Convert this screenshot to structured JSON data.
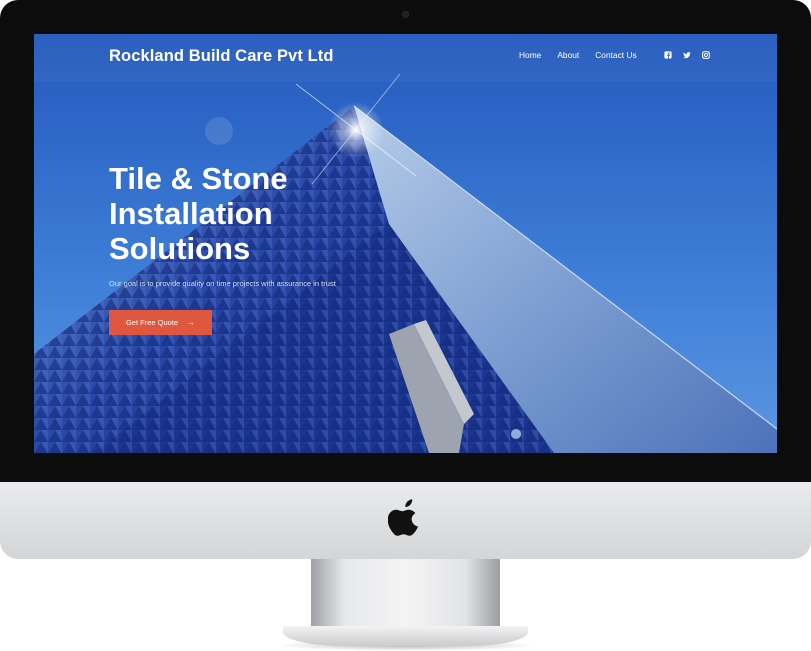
{
  "site": {
    "brand": "Rockland Build Care Pvt Ltd",
    "nav": {
      "home": "Home",
      "about": "About",
      "contact": "Contact Us"
    },
    "social_icons": [
      "facebook-icon",
      "twitter-icon",
      "instagram-icon"
    ]
  },
  "hero": {
    "title_lines": [
      "Tile & Stone",
      "Installation",
      "Solutions"
    ],
    "subtitle": "Our goal is to provide quality on time projects with assurance in trust",
    "cta_label": "Get Free Quote",
    "cta_arrow": "→"
  },
  "colors": {
    "accent": "#e0573f",
    "sky": "#3f7fd9",
    "building": "#1f3f9c",
    "bezel": "#0c0c0c",
    "chin": "#e3e4e6"
  }
}
